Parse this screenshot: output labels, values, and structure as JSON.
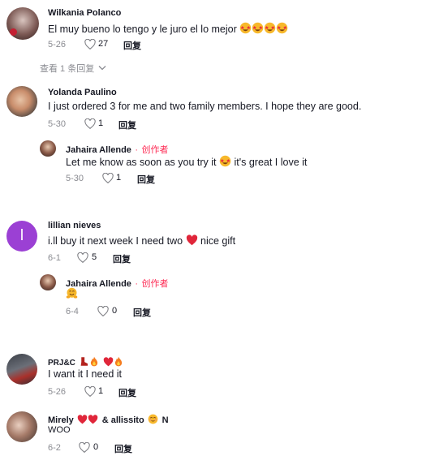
{
  "comments": [
    {
      "author": "Wilkania Polanco",
      "text": "El muy bueno lo tengo y le juro el lo mejor",
      "emoji_count": 4,
      "date": "5-26",
      "likes": "27",
      "reply_label": "回复",
      "view_replies": "查看 1 条回复"
    },
    {
      "author": "Yolanda Paulino",
      "text": "I just ordered 3 for me and two family members. I hope they are good.",
      "date": "5-30",
      "likes": "1",
      "reply_label": "回复",
      "reply": {
        "author": "Jahaira Allende",
        "sep": "·",
        "creator_label": "创作者",
        "text_a": "Let me know as soon as you try it",
        "text_b": "it's great I love it",
        "date": "5-30",
        "likes": "1",
        "reply_label": "回复"
      }
    },
    {
      "author": "lillian nieves",
      "avatar_letter": "l",
      "text_a": "i.ll buy it next week I need two",
      "text_b": "nice gift",
      "date": "6-1",
      "likes": "5",
      "reply_label": "回复",
      "reply": {
        "author": "Jahaira Allende",
        "sep": "·",
        "creator_label": "创作者",
        "date": "6-4",
        "likes": "0",
        "reply_label": "回复"
      }
    },
    {
      "author": "PRJ&C",
      "text": "I want it I need it",
      "date": "5-26",
      "likes": "1",
      "reply_label": "回复"
    },
    {
      "author_a": "Mirely",
      "author_b": "& allissito",
      "author_c": "N",
      "text": "woo",
      "date": "6-2",
      "likes": "0",
      "reply_label": "回复"
    }
  ],
  "colors": {
    "accent": "#fe2c55",
    "muted": "#8a8b91",
    "avatar_purple": "#9b40d4"
  }
}
